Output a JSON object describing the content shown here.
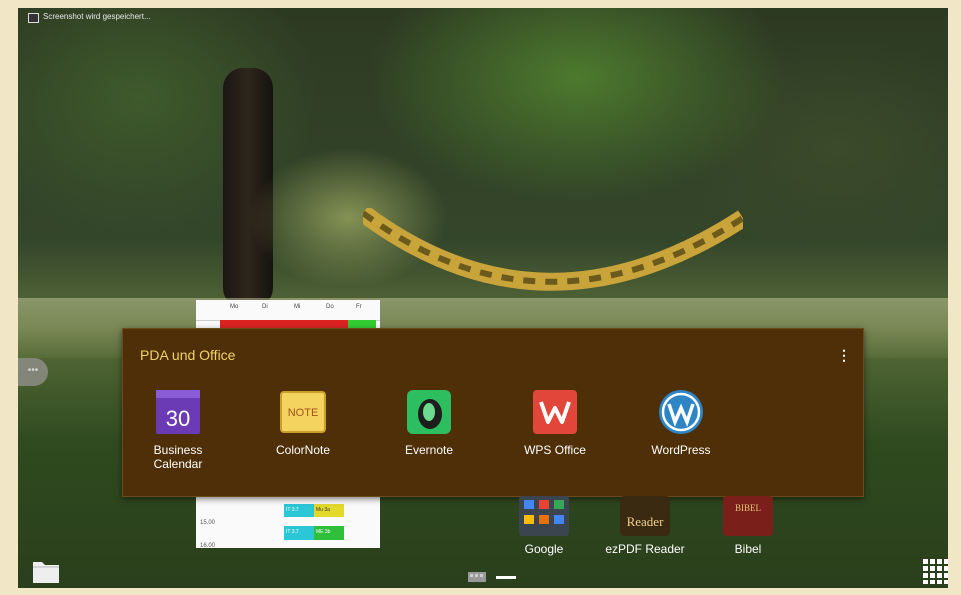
{
  "status_bar": {
    "notification_text": "Screenshot wird gespeichert..."
  },
  "calendar_widget": {
    "days": [
      "Mo",
      "Di",
      "Mi",
      "Do",
      "Fr"
    ],
    "times": [
      "15.00",
      "16.00"
    ],
    "events": [
      "IT 3.7",
      "Mu 3a",
      "IT 3.7",
      "ME 3b"
    ]
  },
  "folder": {
    "title": "PDA und Office",
    "menu_icon": "overflow-menu-icon",
    "apps": [
      {
        "label": "Business Calendar",
        "icon": "business-calendar-icon",
        "icon_text": "30"
      },
      {
        "label": "ColorNote",
        "icon": "colornote-icon",
        "icon_text": "NOTE"
      },
      {
        "label": "Evernote",
        "icon": "evernote-icon"
      },
      {
        "label": "WPS Office",
        "icon": "wps-office-icon"
      },
      {
        "label": "WordPress",
        "icon": "wordpress-icon"
      }
    ]
  },
  "dock": {
    "apps": [
      {
        "label": "Google",
        "icon": "google-folder-icon"
      },
      {
        "label": "ezPDF Reader",
        "icon": "ezpdf-reader-icon",
        "icon_text": "Reader"
      },
      {
        "label": "Bibel",
        "icon": "bibel-icon",
        "icon_text": "BIBEL"
      }
    ]
  },
  "colors": {
    "folder_bg": "#4f2f07",
    "folder_title": "#f0d26a"
  }
}
